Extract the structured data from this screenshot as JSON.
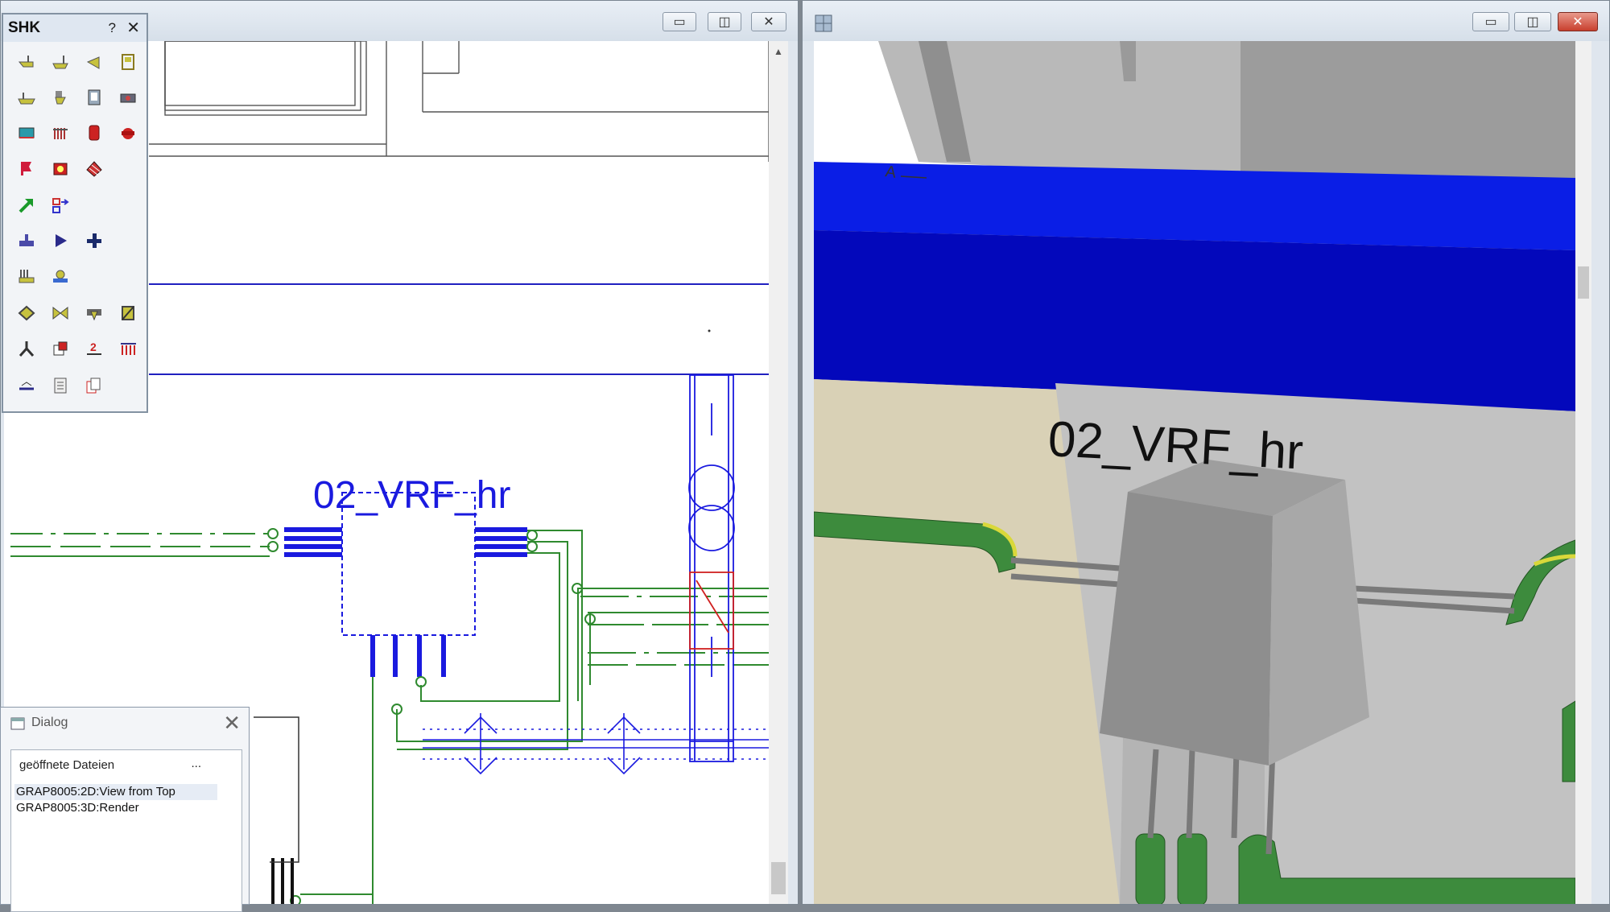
{
  "left_window": {
    "scroll_up_glyph": "▲",
    "drawing_label": "02_VRF_hr"
  },
  "toolbox": {
    "title": "SHK",
    "help": "?",
    "close": "✕"
  },
  "dialog": {
    "title": "Dialog",
    "close": "✕",
    "header": "geöffnete Dateien",
    "more": "...",
    "items": [
      "GRAP8005:2D:View from Top",
      "GRAP8005:3D:Render"
    ]
  },
  "right_window": {
    "drawing_label": "02_VRF_hr",
    "axis_text": "A"
  },
  "window_buttons": {
    "minimize": "▭",
    "restore": "◫",
    "close": "✕"
  },
  "colors": {
    "cad_blue": "#1a1adf",
    "pipe_green": "#2f8a2f",
    "duct_blue": "#0a1ee6"
  }
}
